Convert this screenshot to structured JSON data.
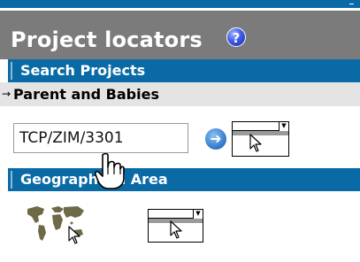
{
  "header": {
    "title": "Project locators",
    "help_icon_glyph": "?"
  },
  "sections": {
    "search_projects": {
      "label": "Search Projects"
    },
    "geographical_area": {
      "label": "Geographical Area"
    }
  },
  "search": {
    "sub_section_label": "Parent and Babies",
    "sub_section_arrow": "→",
    "project_code_value": "TCP/ZIM/3301",
    "go_button_glyph": "➜"
  },
  "dropdown_arrow": "▼",
  "colors": {
    "section_bar": "#0a6aa6",
    "header_bg": "#7b7b7b",
    "sub_section_bg": "#e4e4e4",
    "map_color": "#6e6a47"
  },
  "icons": [
    "help-icon",
    "go-arrow-icon",
    "world-map-icon",
    "dropdown-arrow-icon",
    "arrow-cursor-icon",
    "hand-cursor-icon"
  ]
}
